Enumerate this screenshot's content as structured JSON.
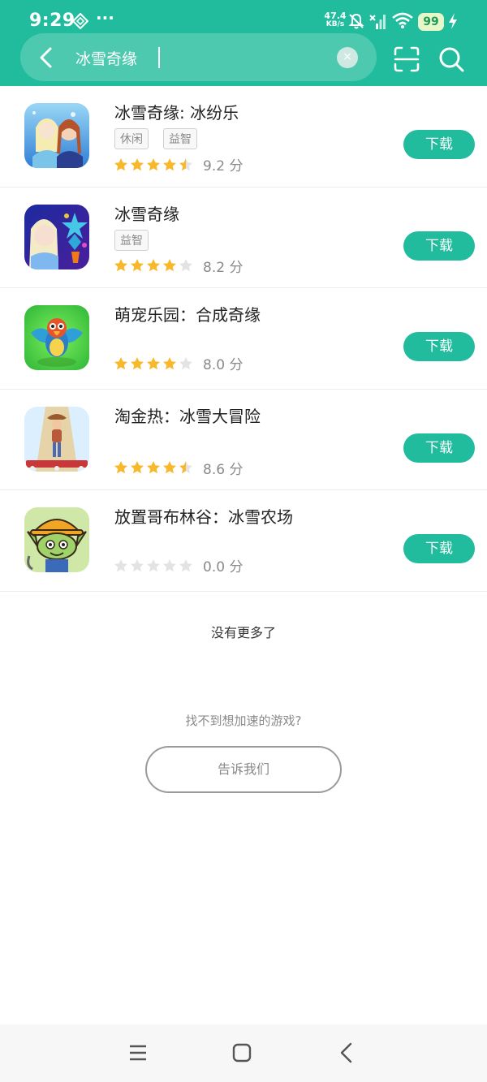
{
  "status_bar": {
    "time": "9:29",
    "more": "···",
    "net_speed_value": "47.4",
    "net_speed_unit": "KB/s",
    "battery": "99",
    "icons": [
      "diamond-app-icon",
      "mute-icon",
      "signal-icon",
      "wifi-icon",
      "charging-icon"
    ]
  },
  "search": {
    "query": "冰雪奇缘",
    "clear_symbol": "×"
  },
  "colors": {
    "accent": "#21bc9d",
    "star": "#f9b829",
    "star_empty": "#e3e3e3"
  },
  "results": [
    {
      "title": "冰雪奇缘: 冰纷乐",
      "tags": [
        "休闲",
        "益智"
      ],
      "rating": 4.5,
      "score_label": "9.2 分",
      "button": "下载"
    },
    {
      "title": "冰雪奇缘",
      "tags": [
        "益智"
      ],
      "rating": 4,
      "score_label": "8.2 分",
      "button": "下载"
    },
    {
      "title": "萌宠乐园：合成奇缘",
      "tags": [],
      "rating": 4,
      "score_label": "8.0 分",
      "button": "下载"
    },
    {
      "title": "淘金热：冰雪大冒险",
      "tags": [],
      "rating": 4.5,
      "score_label": "8.6 分",
      "button": "下载"
    },
    {
      "title": "放置哥布林谷：冰雪农场",
      "tags": [],
      "rating": 0,
      "score_label": "0.0 分",
      "button": "下载"
    }
  ],
  "footer": {
    "no_more": "没有更多了",
    "hint": "找不到想加速的游戏?",
    "tell_us": "告诉我们"
  }
}
